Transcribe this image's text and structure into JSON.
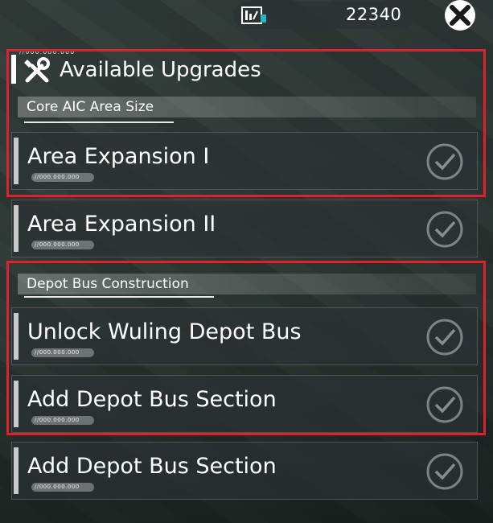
{
  "currency": {
    "icon": "building-funds-icon",
    "value": "22340"
  },
  "close": {
    "icon": "close-icon"
  },
  "panel": {
    "header_icon": "wrench-screwdriver-icon",
    "title": "Available Upgrades",
    "sections": [
      {
        "label": "Core AIC Area Size",
        "items": [
          {
            "title": "Area Expansion I",
            "code": "//000.000.000",
            "status_icon": "check-circle-icon"
          },
          {
            "title": "Area Expansion II",
            "code": "//000.000.000",
            "status_icon": "check-circle-icon"
          }
        ]
      },
      {
        "label": "Depot Bus Construction",
        "items": [
          {
            "title": "Unlock Wuling Depot Bus",
            "code": "//000.000.000",
            "status_icon": "check-circle-icon"
          },
          {
            "title": "Add Depot Bus Section",
            "code": "//000.000.000",
            "status_icon": "check-circle-icon"
          },
          {
            "title": "Add Depot Bus Section",
            "code": "//000.000.000",
            "status_icon": "check-circle-icon"
          }
        ]
      }
    ]
  },
  "colors": {
    "highlight": "#e0202a",
    "accent_teal": "#2bb3c0"
  }
}
